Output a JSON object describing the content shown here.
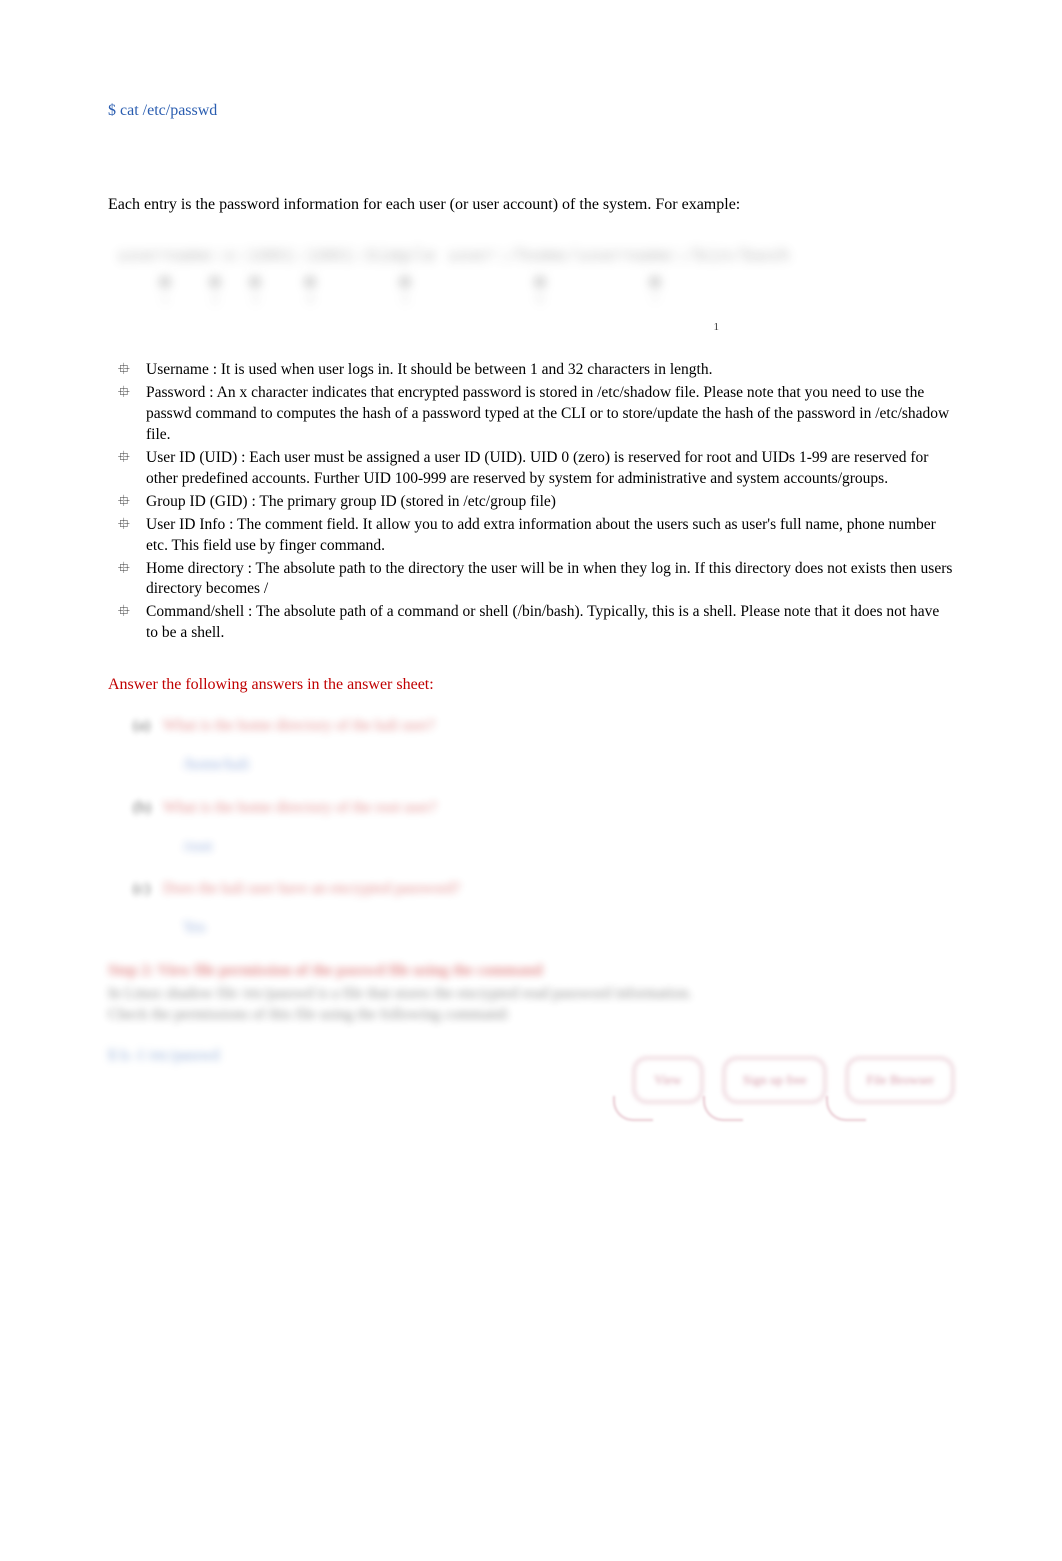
{
  "command1": "$ cat /etc/passwd",
  "intro": "Each entry is the password information for each user (or user account) of the system. For example:",
  "diagram_sample": "username:x:1001:1001:Simple user:/home/username:/bin/bash",
  "page_number": "1",
  "fields": [
    {
      "label": "Username",
      "desc": ": It is used when user logs in. It should be between 1 and 32 characters in length."
    },
    {
      "label": "Password",
      "desc": ": An x character indicates that encrypted password is stored in /etc/shadow file. Please note that you need to use the passwd command to computes the hash of a password typed at the CLI or to store/update the hash of the password in /etc/shadow file."
    },
    {
      "label": "User ID (UID)",
      "desc": ": Each user must be assigned a user ID (UID). UID 0 (zero) is reserved for root and UIDs 1-99 are reserved for other predefined accounts. Further UID 100-999 are reserved by system for administrative and system accounts/groups."
    },
    {
      "label": "Group ID (GID)",
      "desc": " : The primary group ID (stored in /etc/group file)"
    },
    {
      "label": "User ID Info",
      "desc": ": The comment field. It allow you to add extra information about the users such as user's full name, phone number etc. This field use by finger command."
    },
    {
      "label": "Home directory",
      "desc": " : The absolute path to the directory the user will be in when they log in. If this directory does not exists then users directory becomes /"
    },
    {
      "label": "Command/shell",
      "desc": ": The absolute path of a command or shell (/bin/bash). Typically, this is a shell. Please note that it does not have to be a shell."
    }
  ],
  "red_heading": "Answer the following answers in the answer sheet:",
  "questions": [
    {
      "num": "(a)",
      "text": "What is the home directory of the kali user?",
      "answer": "/home/kali"
    },
    {
      "num": "(b)",
      "text": "What is the home directory of the root user?",
      "answer": "/root"
    },
    {
      "num": "(c)",
      "text": "Does the kali user have an encrypted password?",
      "answer": "Yes"
    }
  ],
  "step_title": "Step 2: View file permission of the passwd file using the command",
  "step_desc_line1": "In Linux shadow file /etc/passwd is a file that stores the encrypted read password information.",
  "step_desc_line2": "Check the permissions of this file using the following command:",
  "command2": "$ ls -l /etc/passwd",
  "bubbles": [
    "View",
    "Sign up free",
    "File Browser"
  ]
}
